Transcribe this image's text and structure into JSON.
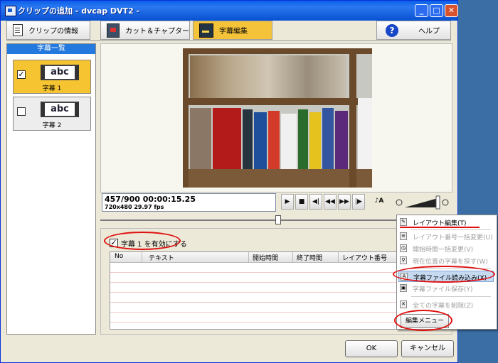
{
  "window": {
    "title": "クリップの追加 - dvcap DVT2 -",
    "min": "_",
    "max": "□",
    "close": "✕"
  },
  "tabs": [
    {
      "label": "クリップの情報",
      "icon": "document-icon"
    },
    {
      "label": "カット＆チャプター",
      "icon": "film-icon"
    },
    {
      "label": "字幕編集",
      "icon": "subtitle-icon",
      "active": true
    },
    {
      "label": "ヘルプ",
      "icon": "help-icon"
    }
  ],
  "help_glyph": "?",
  "sidebar": {
    "header": "字幕一覧",
    "items": [
      {
        "label": "字幕 1",
        "thumb": "abc",
        "checked": true,
        "check": "✓"
      },
      {
        "label": "字幕 2",
        "thumb": "abc",
        "checked": false,
        "check": ""
      }
    ]
  },
  "player": {
    "timecode": "457/900  00:00:15.25",
    "info": "720x480 29.97 fps",
    "controls": [
      "▶",
      "■",
      "◀|",
      "◀◀",
      "▶▶",
      "|▶",
      "♪A"
    ],
    "volume": 0.92
  },
  "editor": {
    "enable_label": "字幕 1 を有効にする",
    "enable_check": "✓",
    "columns": [
      "No",
      "テキスト",
      "開始時間",
      "終了時間",
      "レイアウト番号"
    ]
  },
  "menu": {
    "items": [
      {
        "label": "レイアウト編集(T)",
        "enabled": true
      },
      {
        "label": "レイアウト番号一括変更(U)",
        "enabled": false
      },
      {
        "label": "開始時間一括変更(V)",
        "enabled": false
      },
      {
        "label": "現在位置の字幕を探す(W)",
        "enabled": false
      },
      {
        "label": "字幕ファイル読み込み(X)",
        "enabled": true
      },
      {
        "label": "字幕ファイル保存(Y)",
        "enabled": false
      },
      {
        "label": "全ての字幕を削除(Z)",
        "enabled": false
      }
    ],
    "button": "編集メニュー"
  },
  "dialog": {
    "ok": "OK",
    "cancel": "キャンセル"
  },
  "colors": {
    "active_tab": "#f5c33a",
    "title_bar": "#0a5fe8",
    "annotation": "#e01010"
  }
}
